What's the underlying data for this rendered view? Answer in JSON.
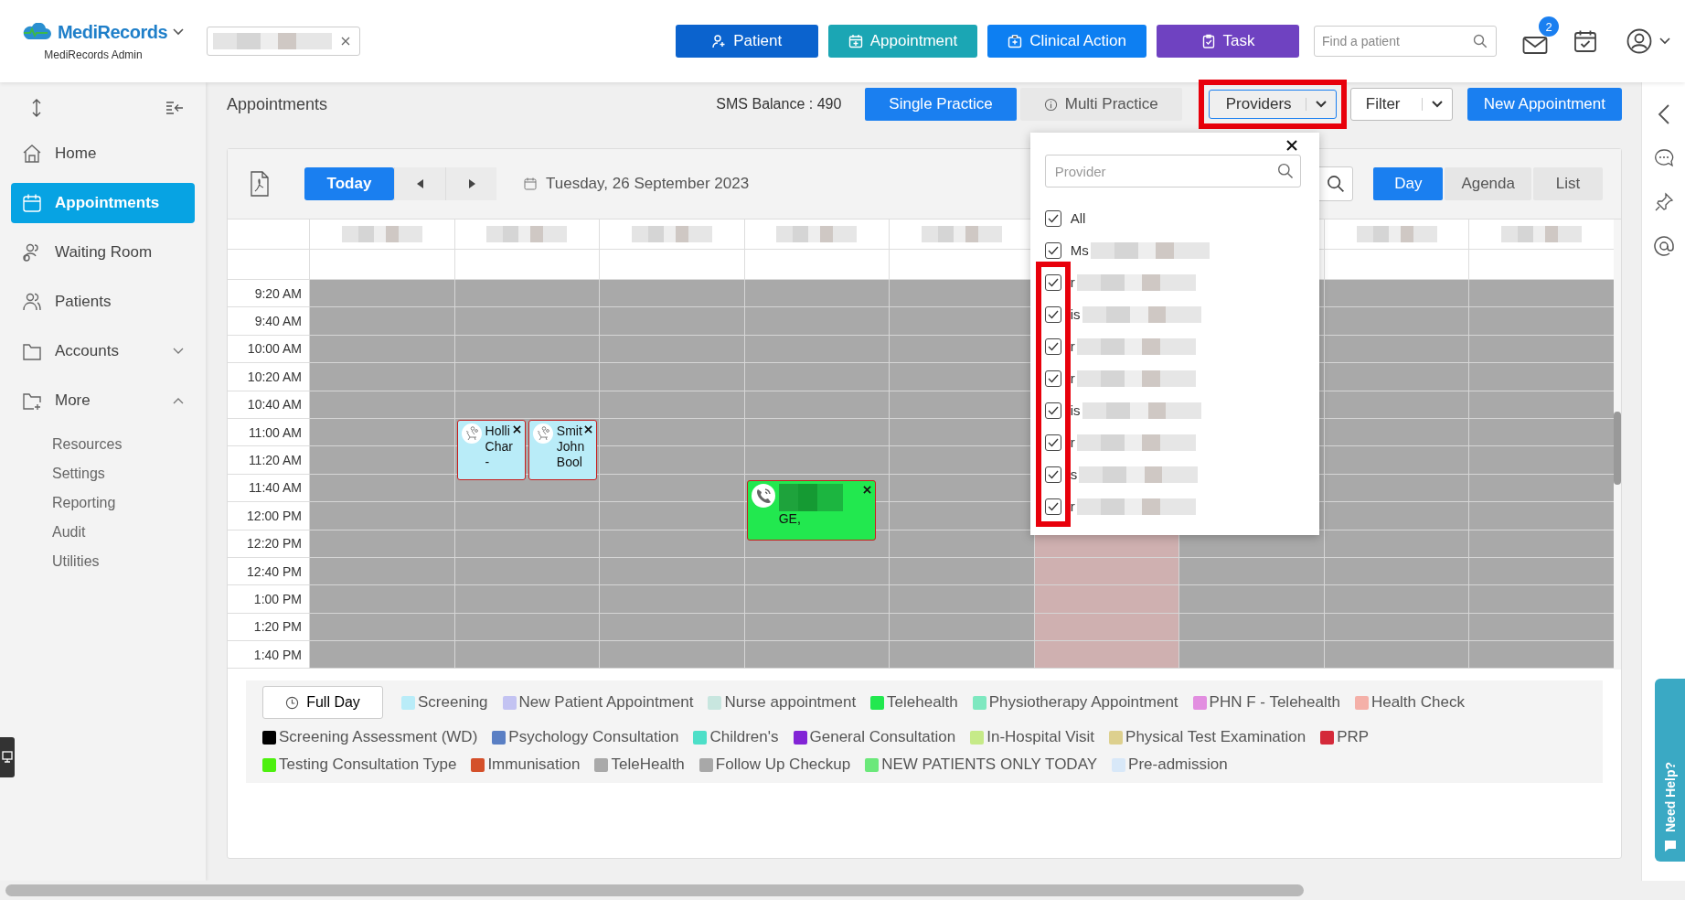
{
  "header": {
    "logo": {
      "name": "MediRecords",
      "subtitle": "MediRecords Admin"
    },
    "actions": [
      {
        "label": "Patient",
        "kind": "patient",
        "color": "#0b63ce"
      },
      {
        "label": "Appointment",
        "kind": "appointment",
        "color": "#1ba6b4"
      },
      {
        "label": "Clinical Action",
        "kind": "clinical",
        "color": "#0d7ff2"
      },
      {
        "label": "Task",
        "kind": "task",
        "color": "#6f42c1"
      }
    ],
    "search": {
      "placeholder": "Find a patient"
    },
    "mail_badge": "2"
  },
  "sidebar": {
    "items": [
      {
        "label": "Home",
        "kind": "link",
        "selected": false
      },
      {
        "label": "Appointments",
        "kind": "link",
        "selected": true
      },
      {
        "label": "Waiting Room",
        "kind": "link",
        "selected": false
      },
      {
        "label": "Patients",
        "kind": "link",
        "selected": false
      },
      {
        "label": "Accounts",
        "kind": "group",
        "selected": false,
        "expanded": false
      },
      {
        "label": "More",
        "kind": "group",
        "selected": false,
        "expanded": true,
        "children": [
          {
            "label": "Resources"
          },
          {
            "label": "Settings"
          },
          {
            "label": "Reporting"
          },
          {
            "label": "Audit"
          },
          {
            "label": "Utilities"
          }
        ]
      }
    ]
  },
  "toolbar": {
    "title": "Appointments",
    "sms_balance": "SMS Balance : 490",
    "modes": [
      {
        "label": "Single Practice",
        "selected": true
      },
      {
        "label": "Multi Practice",
        "selected": false
      }
    ],
    "providers": {
      "label": "Providers",
      "highlighted": true
    },
    "filter": {
      "label": "Filter"
    },
    "new_button": "New Appointment"
  },
  "provider_dropdown": {
    "placeholder": "Provider",
    "items": [
      {
        "label": "All",
        "checked": true,
        "redacted": false,
        "highlighted": false
      },
      {
        "label": "Ms",
        "checked": true,
        "redacted": true,
        "highlighted": false
      },
      {
        "label": "r",
        "checked": true,
        "redacted": true,
        "highlighted": true
      },
      {
        "label": "is",
        "checked": true,
        "redacted": true,
        "highlighted": true
      },
      {
        "label": "r",
        "checked": true,
        "redacted": true,
        "highlighted": true
      },
      {
        "label": "r",
        "checked": true,
        "redacted": true,
        "highlighted": true
      },
      {
        "label": "is",
        "checked": true,
        "redacted": true,
        "highlighted": true
      },
      {
        "label": "r",
        "checked": true,
        "redacted": true,
        "highlighted": true
      },
      {
        "label": "s",
        "checked": true,
        "redacted": true,
        "highlighted": true
      },
      {
        "label": "r",
        "checked": true,
        "redacted": true,
        "highlighted": true
      }
    ]
  },
  "calendar": {
    "today": "Today",
    "date": "Tuesday, 26 September 2023",
    "views": [
      {
        "label": "Day",
        "selected": true
      },
      {
        "label": "Agenda",
        "selected": false
      },
      {
        "label": "List",
        "selected": false
      }
    ],
    "rows": [
      {
        "time": "9:20 AM",
        "cells": [
          {},
          {},
          {},
          {},
          {},
          {},
          {},
          {},
          {}
        ]
      },
      {
        "time": "9:40 AM",
        "cells": [
          {},
          {},
          {},
          {},
          {},
          {},
          {},
          {},
          {}
        ]
      },
      {
        "time": "10:00 AM",
        "cells": [
          {},
          {},
          {},
          {},
          {},
          {},
          {},
          {},
          {}
        ]
      },
      {
        "time": "10:20 AM",
        "cells": [
          {},
          {},
          {},
          {},
          {},
          {},
          {},
          {},
          {}
        ]
      },
      {
        "time": "10:40 AM",
        "cells": [
          {},
          {},
          {},
          {},
          {},
          {},
          {},
          {},
          {}
        ]
      },
      {
        "time": "11:00 AM",
        "cells": [
          {},
          {
            "blocks": [
              {
                "kind": "consult",
                "color": "#b9ecf8",
                "lines": [
                  "Holli",
                  "Char",
                  "-"
                ],
                "redacted": false
              },
              {
                "kind": "consult",
                "color": "#b9ecf8",
                "lines": [
                  "Smit",
                  "John",
                  "Bool"
                ],
                "redacted": false
              }
            ]
          },
          {},
          {},
          {},
          {},
          {},
          {},
          {}
        ]
      },
      {
        "time": "11:20 AM",
        "cells": [
          {},
          {},
          {},
          {},
          {},
          {},
          {},
          {},
          {}
        ]
      },
      {
        "time": "11:40 AM",
        "cells": [
          {},
          {},
          {},
          {
            "blocks": [
              {
                "kind": "phone",
                "color": "#22e84f",
                "lines": [
                  "GE,"
                ],
                "redacted": true
              }
            ]
          },
          {},
          {},
          {},
          {},
          {}
        ]
      },
      {
        "time": "12:00 PM",
        "cells": [
          {},
          {},
          {},
          {},
          {},
          {},
          {},
          {},
          {}
        ]
      },
      {
        "time": "12:20 PM",
        "cells": [
          {},
          {},
          {},
          {},
          {},
          {
            "blocks": [
              {
                "kind": "unavailable"
              }
            ]
          },
          {},
          {},
          {}
        ]
      },
      {
        "time": "12:40 PM",
        "cells": [
          {},
          {},
          {},
          {},
          {},
          {
            "blocks": [
              {
                "kind": "unavailable"
              }
            ]
          },
          {},
          {},
          {}
        ]
      },
      {
        "time": "1:00 PM",
        "cells": [
          {},
          {},
          {},
          {},
          {},
          {
            "blocks": [
              {
                "kind": "unavailable"
              }
            ]
          },
          {},
          {},
          {}
        ]
      },
      {
        "time": "1:20 PM",
        "cells": [
          {},
          {},
          {},
          {},
          {},
          {
            "blocks": [
              {
                "kind": "unavailable"
              }
            ]
          },
          {},
          {},
          {}
        ]
      },
      {
        "time": "1:40 PM",
        "cells": [
          {},
          {},
          {},
          {},
          {},
          {
            "blocks": [
              {
                "kind": "unavailable"
              }
            ]
          },
          {},
          {},
          {}
        ]
      }
    ]
  },
  "legend": {
    "full_day": "Full Day",
    "items": [
      {
        "label": "Screening",
        "color": "#b9ecf8"
      },
      {
        "label": "New Patient Appointment",
        "color": "#c3c3f2"
      },
      {
        "label": "Nurse appointment",
        "color": "#c8e6df"
      },
      {
        "label": "Telehealth",
        "color": "#22e84f"
      },
      {
        "label": "Physiotherapy Appointment",
        "color": "#7ee8c0"
      },
      {
        "label": "PHN F - Telehealth",
        "color": "#e28ee0"
      },
      {
        "label": "Health Check",
        "color": "#f4b0a8"
      },
      {
        "label": "Screening Assessment (WD)",
        "color": "#000000"
      },
      {
        "label": "Psychology Consultation",
        "color": "#5a7fc4"
      },
      {
        "label": "Children's",
        "color": "#4ddfc8"
      },
      {
        "label": "General Consultation",
        "color": "#8224d6"
      },
      {
        "label": "In-Hospital Visit",
        "color": "#c6ea88"
      },
      {
        "label": "Physical Test Examination",
        "color": "#ddd08e"
      },
      {
        "label": "PRP",
        "color": "#d42a3a"
      },
      {
        "label": "Testing Consultation Type",
        "color": "#4df00e"
      },
      {
        "label": "Immunisation",
        "color": "#d4502a"
      },
      {
        "label": "TeleHealth",
        "color": "#a9a9a9"
      },
      {
        "label": "Follow Up Checkup",
        "color": "#a8a8a8"
      },
      {
        "label": "NEW PATIENTS ONLY TODAY",
        "color": "#6be87a"
      },
      {
        "label": "Pre-admission",
        "color": "#d8e8f8"
      }
    ]
  },
  "help_tab": "Need Help?"
}
